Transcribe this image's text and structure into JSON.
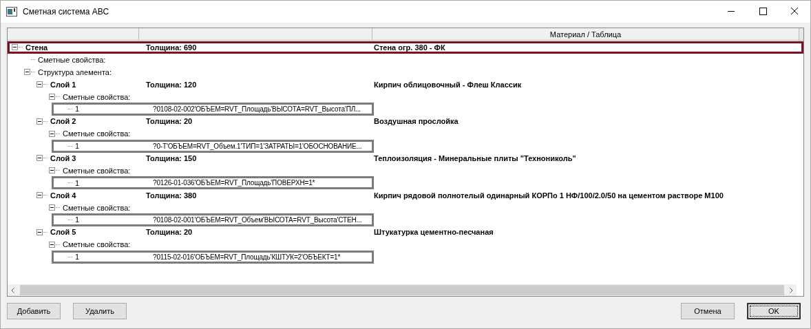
{
  "window": {
    "title": "Сметная система АВС"
  },
  "header": {
    "column_3": "Материал / Таблица"
  },
  "tree": [
    {
      "kind": "element",
      "name": "Стена",
      "thickness": "Толщина:  690",
      "material": "Стена огр. 380 - ФК",
      "selected": true,
      "expanded": true,
      "children": [
        {
          "kind": "section",
          "label": "Сметные свойства:"
        },
        {
          "kind": "section",
          "label": "Структура элемента:",
          "expanded": true,
          "children": [
            {
              "kind": "element",
              "name": "Слой 1",
              "thickness": "Толщина:  120",
              "material": "Кирпич облицовочный - Флеш Классик",
              "selected": false,
              "expanded": true,
              "children": [
                {
                  "kind": "section",
                  "label": "Сметные свойства:",
                  "expanded": true,
                  "children": [
                    {
                      "kind": "property",
                      "index": "1",
                      "code": "?0108-02-002'ОБЪЕМ=RVT_Площадь'ВЫСОТА=RVT_Высота'ПЛ...",
                      "marked": true
                    }
                  ]
                }
              ]
            },
            {
              "kind": "element",
              "name": "Слой 2",
              "thickness": "Толщина:  20",
              "material": "Воздушная прослойка",
              "selected": false,
              "expanded": true,
              "children": [
                {
                  "kind": "section",
                  "label": "Сметные свойства:",
                  "expanded": true,
                  "children": [
                    {
                      "kind": "property",
                      "index": "1",
                      "code": "?0-Т'ОБЪЕМ=RVT_Объем.1'ТИП=1'ЗАТРАТЫ=1'ОБОСНОВАНИЕ...",
                      "marked": true
                    }
                  ]
                }
              ]
            },
            {
              "kind": "element",
              "name": "Слой 3",
              "thickness": "Толщина:  150",
              "material": "Теплоизоляция - Минеральные плиты \"Технониколь\"",
              "selected": false,
              "expanded": true,
              "children": [
                {
                  "kind": "section",
                  "label": "Сметные свойства:",
                  "expanded": true,
                  "children": [
                    {
                      "kind": "property",
                      "index": "1",
                      "code": "?0126-01-036'ОБЪЕМ=RVT_Площадь'ПОВЕРХН=1*",
                      "marked": true
                    }
                  ]
                }
              ]
            },
            {
              "kind": "element",
              "name": "Слой 4",
              "thickness": "Толщина:  380",
              "material": "Кирпич рядовой полнотелый одинарный КОРПо 1 НФ/100/2.0/50 на цементом растворе М100",
              "selected": false,
              "expanded": true,
              "children": [
                {
                  "kind": "section",
                  "label": "Сметные свойства:",
                  "expanded": true,
                  "children": [
                    {
                      "kind": "property",
                      "index": "1",
                      "code": "?0108-02-001'ОБЪЕМ=RVT_Объем'ВЫСОТА=RVT_Высота'СТЕН...",
                      "marked": true
                    }
                  ]
                }
              ]
            },
            {
              "kind": "element",
              "name": "Слой 5",
              "thickness": "Толщина:  20",
              "material": "Штукатурка цементно-песчаная",
              "selected": false,
              "expanded": true,
              "children": [
                {
                  "kind": "section",
                  "label": "Сметные свойства:",
                  "expanded": true,
                  "children": [
                    {
                      "kind": "property",
                      "index": "1",
                      "code": "?0115-02-016'ОБЪЕМ=RVT_Площадь'КШТУК=2'ОБЪЕКТ=1*",
                      "marked": true
                    }
                  ]
                }
              ]
            }
          ]
        }
      ]
    }
  ],
  "buttons_left": [
    "Добавить",
    "Удалить"
  ],
  "buttons_right": [
    {
      "label": "Отмена",
      "default": false
    },
    {
      "label": "OK",
      "default": true
    }
  ]
}
